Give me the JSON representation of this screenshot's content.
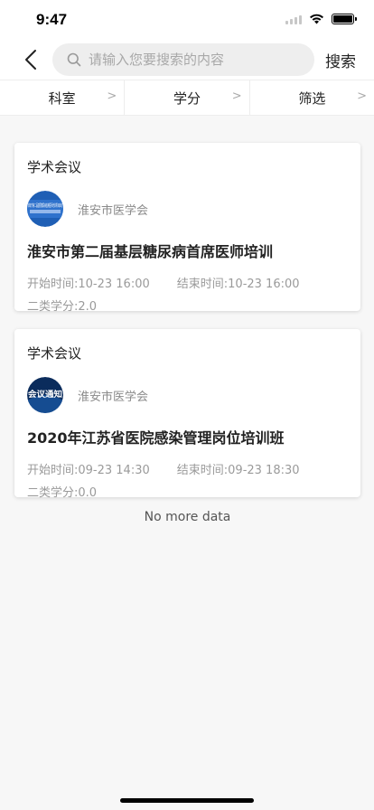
{
  "status": {
    "time": "9:47"
  },
  "nav": {
    "search_placeholder": "请输入您要搜索的内容",
    "search_button": "搜索"
  },
  "filters": [
    {
      "label": "科室",
      "arrow": ">"
    },
    {
      "label": "学分",
      "arrow": ">"
    },
    {
      "label": "筛选",
      "arrow": ">"
    }
  ],
  "cards": [
    {
      "type": "学术会议",
      "org": "淮安市医学会",
      "logo_text": "淮安市第二届基层糖尿病首席医师培训项目启动",
      "title": "淮安市第二届基层糖尿病首席医师培训",
      "start": "开始时间:10-23 16:00",
      "end": "结束时间:10-23 16:00",
      "credit": "二类学分:2.0"
    },
    {
      "type": "学术会议",
      "org": "淮安市医学会",
      "logo_text": "会议通知",
      "title": "2020年江苏省医院感染管理岗位培训班",
      "start": "开始时间:09-23 14:30",
      "end": "结束时间:09-23 18:30",
      "credit": "二类学分:0.0"
    }
  ],
  "footer": {
    "no_more": "No more data"
  },
  "colors": {
    "logo_blue": "#1f5fb5",
    "logo_dark": "#0b2c5c"
  }
}
